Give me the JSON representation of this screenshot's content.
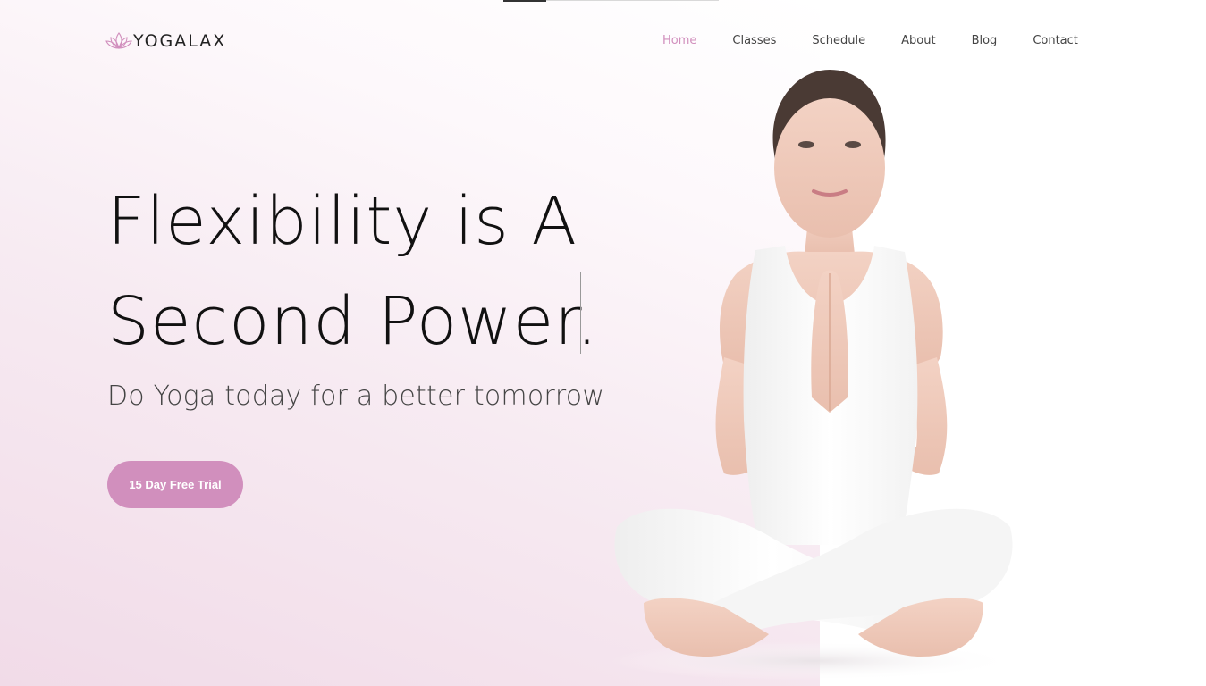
{
  "brand": {
    "name": "YOGALAX",
    "logo_icon": "lotus-icon",
    "accent": "#d18fbd"
  },
  "nav": {
    "items": [
      {
        "label": "Home",
        "active": true
      },
      {
        "label": "Classes",
        "active": false
      },
      {
        "label": "Schedule",
        "active": false
      },
      {
        "label": "About",
        "active": false
      },
      {
        "label": "Blog",
        "active": false
      },
      {
        "label": "Contact",
        "active": false
      }
    ]
  },
  "hero": {
    "title_line1": "Flexibility is A",
    "title_line2": "Second Power.",
    "subtitle": "Do Yoga today for a better tomorrow",
    "cta_label": "15 Day Free Trial"
  },
  "image": {
    "subject": "woman-meditating-photo"
  }
}
